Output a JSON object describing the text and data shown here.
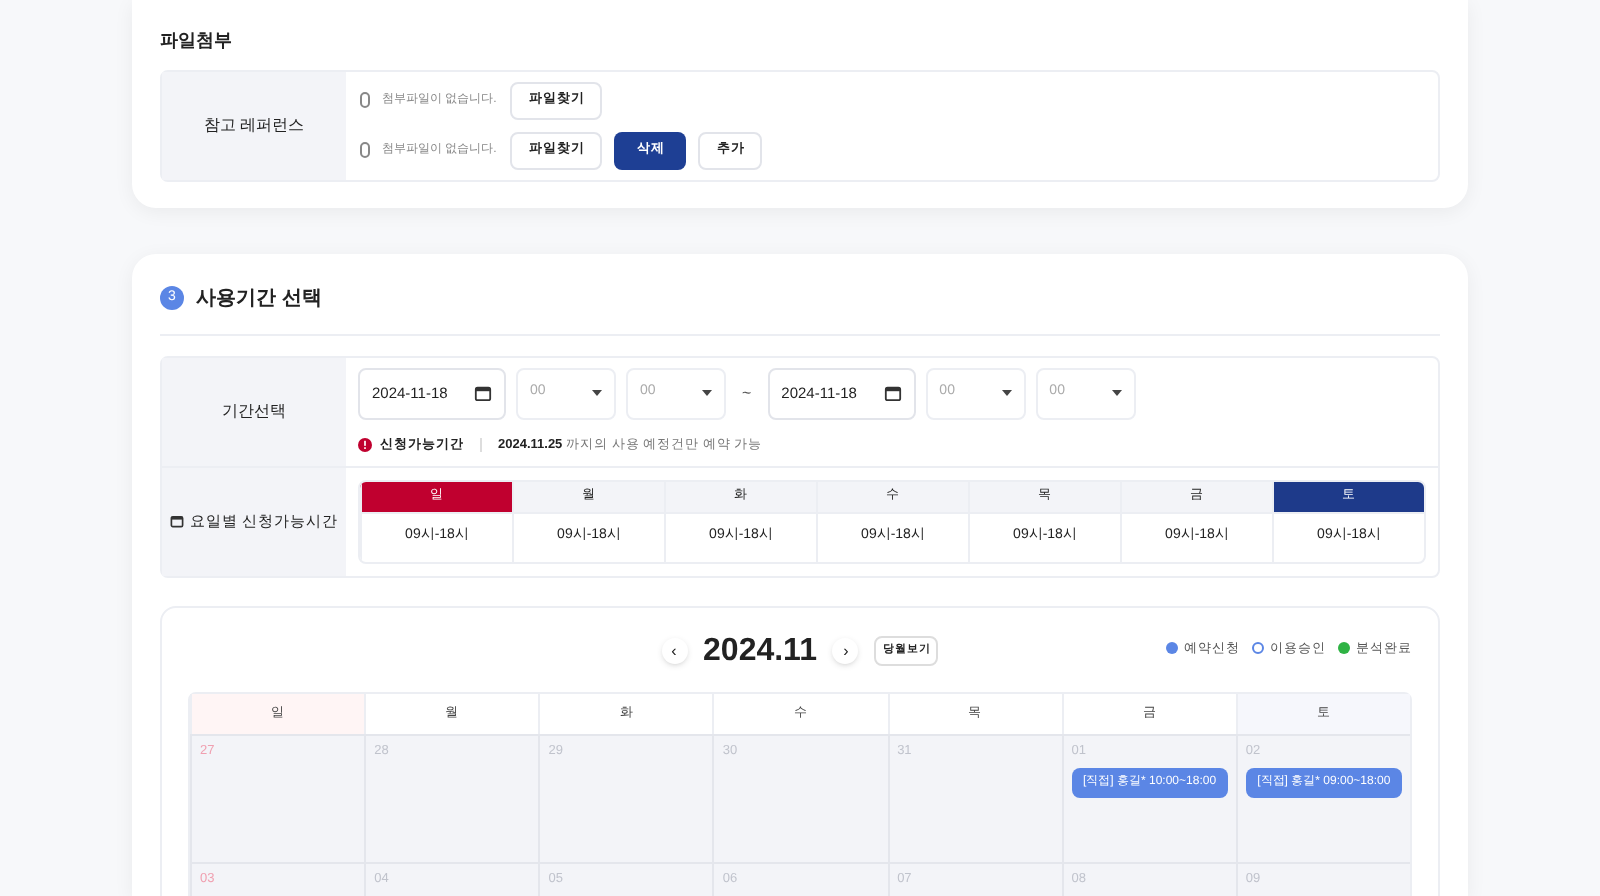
{
  "attachments": {
    "title": "파일첨부",
    "label": "참고 레퍼런스",
    "rows": [
      {
        "text": "첨부파일이 없습니다.",
        "buttons": [
          {
            "label": "파일찾기",
            "kind": "plain"
          }
        ]
      },
      {
        "text": "첨부파일이 없습니다.",
        "buttons": [
          {
            "label": "파일찾기",
            "kind": "plain"
          },
          {
            "label": "삭제",
            "kind": "primary"
          },
          {
            "label": "추가",
            "kind": "plain"
          }
        ]
      }
    ]
  },
  "period": {
    "step": "3",
    "title": "사용기간 선택",
    "range_label": "기간선택",
    "start": {
      "date": "2024-11-18",
      "hour": "00",
      "minute": "00"
    },
    "separator": "~",
    "end": {
      "date": "2024-11-18",
      "hour": "00",
      "minute": "00"
    },
    "notice": {
      "label": "신청가능기간",
      "date": "2024.11.25",
      "text": "까지의 사용 예정건만 예약 가능"
    },
    "weekday_label": "요일별 신청가능시간",
    "weekdays": [
      {
        "day": "일",
        "hours": "09시-18시",
        "color": "#c0002f"
      },
      {
        "day": "월",
        "hours": "09시-18시"
      },
      {
        "day": "화",
        "hours": "09시-18시"
      },
      {
        "day": "수",
        "hours": "09시-18시"
      },
      {
        "day": "목",
        "hours": "09시-18시"
      },
      {
        "day": "금",
        "hours": "09시-18시"
      },
      {
        "day": "토",
        "hours": "09시-18시",
        "color": "#1e3a8a"
      }
    ]
  },
  "calendar": {
    "prev": "‹",
    "month": "2024.11",
    "next": "›",
    "today_button": "당월보기",
    "legend": [
      {
        "label": "예약신청",
        "color": "#5b86e5",
        "kind": "dot"
      },
      {
        "label": "이용승인",
        "color": "#5b86e5",
        "kind": "ring"
      },
      {
        "label": "분석완료",
        "color": "#2fb344",
        "kind": "dot"
      }
    ],
    "headers": [
      "일",
      "월",
      "화",
      "수",
      "목",
      "금",
      "토"
    ],
    "weeks": [
      [
        {
          "date": "27"
        },
        {
          "date": "28"
        },
        {
          "date": "29"
        },
        {
          "date": "30"
        },
        {
          "date": "31"
        },
        {
          "date": "01",
          "events": [
            "[직접] 홍길* 10:00~18:00"
          ]
        },
        {
          "date": "02",
          "events": [
            "[직접] 홍길* 09:00~18:00"
          ]
        }
      ],
      [
        {
          "date": "03"
        },
        {
          "date": "04"
        },
        {
          "date": "05"
        },
        {
          "date": "06"
        },
        {
          "date": "07"
        },
        {
          "date": "08"
        },
        {
          "date": "09"
        }
      ]
    ]
  }
}
